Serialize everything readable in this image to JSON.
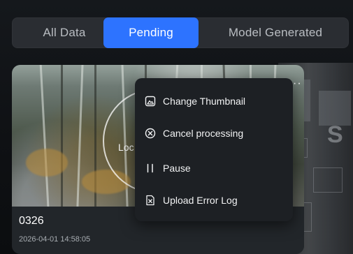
{
  "tabs": {
    "all_label": "All Data",
    "pending_label": "Pending",
    "model_label": "Model Generated",
    "active": "Pending",
    "active_color": "#2d73ff"
  },
  "card": {
    "title": "0326",
    "date": "2026-04-01 14:58:05",
    "overlay_label": "Loc",
    "more_glyph": "··"
  },
  "menu": {
    "items": [
      {
        "label": "Change Thumbnail",
        "icon": "image-icon"
      },
      {
        "label": "Cancel processing",
        "icon": "cancel-circle-icon"
      },
      {
        "label": "Pause",
        "icon": "pause-icon"
      },
      {
        "label": "Upload Error Log",
        "icon": "error-log-icon"
      }
    ]
  },
  "background": {
    "right_glyph": "S"
  }
}
